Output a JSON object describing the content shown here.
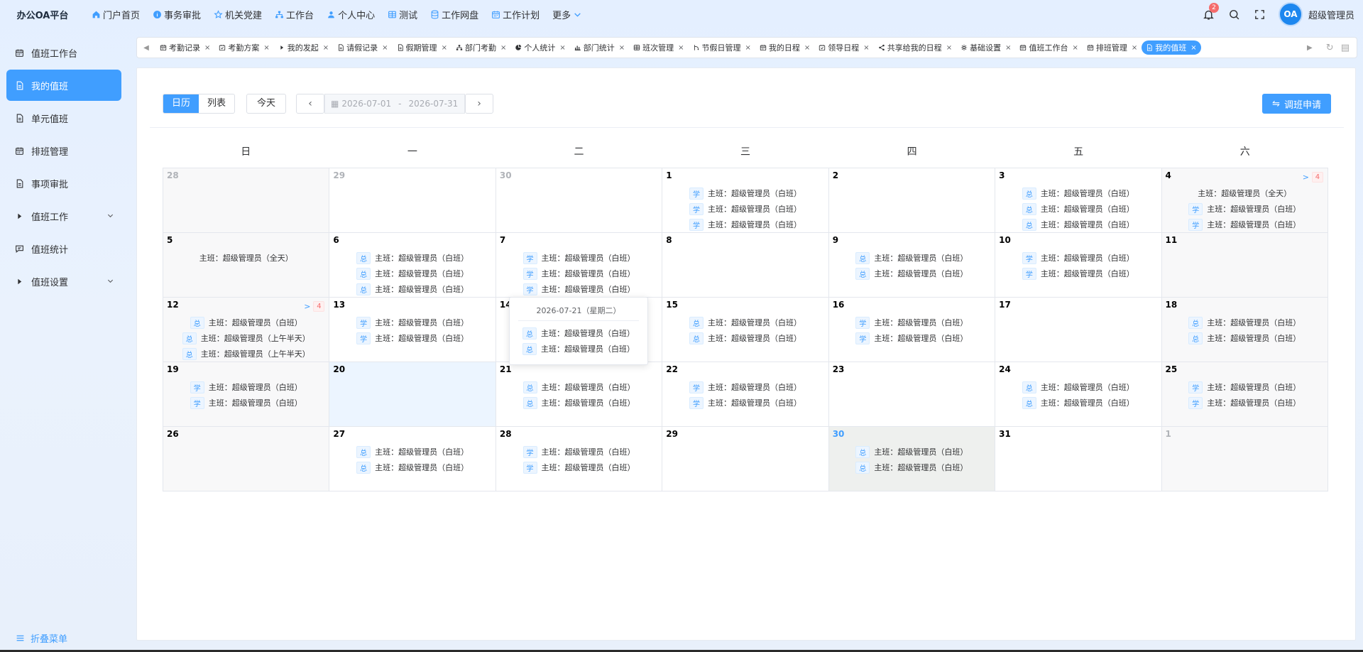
{
  "brand": "办公OA平台",
  "topnav": [
    {
      "label": "门户首页",
      "icon": "home-icon"
    },
    {
      "label": "事务审批",
      "icon": "info-icon"
    },
    {
      "label": "机关党建",
      "icon": "star-icon"
    },
    {
      "label": "工作台",
      "icon": "sitemap-icon"
    },
    {
      "label": "个人中心",
      "icon": "user-icon"
    },
    {
      "label": "测试",
      "icon": "grid-icon"
    },
    {
      "label": "工作网盘",
      "icon": "database-icon"
    },
    {
      "label": "工作计划",
      "icon": "calendar-icon"
    },
    {
      "label": "更多",
      "icon": "chevron-down-icon"
    }
  ],
  "user": {
    "name": "超级管理员",
    "avatar_text": "OA",
    "notify_count": "2"
  },
  "sidebar": {
    "items": [
      {
        "label": "值班工作台",
        "icon": "calendar-icon"
      },
      {
        "label": "我的值班",
        "icon": "document-icon",
        "active": true
      },
      {
        "label": "单元值班",
        "icon": "document-icon"
      },
      {
        "label": "排班管理",
        "icon": "calendar-icon"
      },
      {
        "label": "事项审批",
        "icon": "document-icon"
      },
      {
        "label": "值班工作",
        "icon": "caret-right-icon",
        "expandable": true
      },
      {
        "label": "值班统计",
        "icon": "chat-icon"
      },
      {
        "label": "值班设置",
        "icon": "caret-right-icon",
        "expandable": true
      }
    ],
    "collapse_label": "折叠菜单"
  },
  "tabs": [
    {
      "label": "考勤记录",
      "icon": "calendar-icon"
    },
    {
      "label": "考勤方案",
      "icon": "calendar-check-icon"
    },
    {
      "label": "我的发起",
      "icon": "caret-right-icon"
    },
    {
      "label": "请假记录",
      "icon": "document-icon"
    },
    {
      "label": "假期管理",
      "icon": "document-icon"
    },
    {
      "label": "部门考勤",
      "icon": "sitemap-icon"
    },
    {
      "label": "个人统计",
      "icon": "pie-icon"
    },
    {
      "label": "部门统计",
      "icon": "bar-icon"
    },
    {
      "label": "班次管理",
      "icon": "grid-icon"
    },
    {
      "label": "节假日管理",
      "icon": "branch-icon"
    },
    {
      "label": "我的日程",
      "icon": "calendar-icon"
    },
    {
      "label": "领导日程",
      "icon": "calendar-check-icon"
    },
    {
      "label": "共享给我的日程",
      "icon": "share-icon"
    },
    {
      "label": "基础设置",
      "icon": "gear-icon"
    },
    {
      "label": "值班工作台",
      "icon": "calendar-icon"
    },
    {
      "label": "排班管理",
      "icon": "calendar-icon"
    },
    {
      "label": "我的值班",
      "icon": "document-icon",
      "active": true
    }
  ],
  "toolbar": {
    "view_calendar": "日历",
    "view_list": "列表",
    "today": "今天",
    "range_start": "2026-07-01",
    "range_sep": "-",
    "range_end": "2026-07-31",
    "apply_label": "调班申请"
  },
  "weekdays": [
    "日",
    "一",
    "二",
    "三",
    "四",
    "五",
    "六"
  ],
  "weeks": [
    [
      {
        "day": "28",
        "other": true,
        "weekend": true,
        "events": []
      },
      {
        "day": "29",
        "other": true,
        "events": []
      },
      {
        "day": "30",
        "other": true,
        "events": []
      },
      {
        "day": "1",
        "events": [
          {
            "tag": "学",
            "text": "主班：超级管理员（白班）"
          },
          {
            "tag": "学",
            "text": "主班：超级管理员（白班）"
          },
          {
            "tag": "学",
            "text": "主班：超级管理员（白班）"
          }
        ]
      },
      {
        "day": "2",
        "events": []
      },
      {
        "day": "3",
        "events": [
          {
            "tag": "总",
            "text": "主班：超级管理员（白班）"
          },
          {
            "tag": "总",
            "text": "主班：超级管理员（白班）"
          },
          {
            "tag": "总",
            "text": "主班：超级管理员（白班）"
          }
        ]
      },
      {
        "day": "4",
        "weekend": true,
        "more": "4",
        "events": [
          {
            "tag": "",
            "text": "主班：超级管理员（全天）"
          },
          {
            "tag": "学",
            "text": "主班：超级管理员（白班）"
          },
          {
            "tag": "学",
            "text": "主班：超级管理员（白班）"
          }
        ]
      }
    ],
    [
      {
        "day": "5",
        "weekend": true,
        "events": [
          {
            "tag": "",
            "text": "主班：超级管理员（全天）"
          }
        ]
      },
      {
        "day": "6",
        "events": [
          {
            "tag": "总",
            "text": "主班：超级管理员（白班）"
          },
          {
            "tag": "总",
            "text": "主班：超级管理员（白班）"
          },
          {
            "tag": "总",
            "text": "主班：超级管理员（白班）"
          }
        ]
      },
      {
        "day": "7",
        "events": [
          {
            "tag": "学",
            "text": "主班：超级管理员（白班）"
          },
          {
            "tag": "学",
            "text": "主班：超级管理员（白班）"
          },
          {
            "tag": "学",
            "text": "主班：超级管理员（白班）"
          }
        ]
      },
      {
        "day": "8",
        "events": []
      },
      {
        "day": "9",
        "events": [
          {
            "tag": "总",
            "text": "主班：超级管理员（白班）"
          },
          {
            "tag": "总",
            "text": "主班：超级管理员（白班）"
          }
        ]
      },
      {
        "day": "10",
        "events": [
          {
            "tag": "学",
            "text": "主班：超级管理员（白班）"
          },
          {
            "tag": "学",
            "text": "主班：超级管理员（白班）"
          }
        ]
      },
      {
        "day": "11",
        "weekend": true,
        "events": []
      }
    ],
    [
      {
        "day": "12",
        "weekend": true,
        "more": "4",
        "events": [
          {
            "tag": "总",
            "text": "主班：超级管理员（白班）"
          },
          {
            "tag": "总",
            "text": "主班：超级管理员（上午半天）"
          },
          {
            "tag": "总",
            "text": "主班：超级管理员（上午半天）"
          }
        ]
      },
      {
        "day": "13",
        "events": [
          {
            "tag": "学",
            "text": "主班：超级管理员（白班）"
          },
          {
            "tag": "学",
            "text": "主班：超级管理员（白班）"
          }
        ]
      },
      {
        "day": "14",
        "events": []
      },
      {
        "day": "15",
        "events": [
          {
            "tag": "总",
            "text": "主班：超级管理员（白班）"
          },
          {
            "tag": "总",
            "text": "主班：超级管理员（白班）"
          }
        ]
      },
      {
        "day": "16",
        "events": [
          {
            "tag": "学",
            "text": "主班：超级管理员（白班）"
          },
          {
            "tag": "学",
            "text": "主班：超级管理员（白班）"
          }
        ]
      },
      {
        "day": "17",
        "events": []
      },
      {
        "day": "18",
        "weekend": true,
        "events": [
          {
            "tag": "总",
            "text": "主班：超级管理员（白班）"
          },
          {
            "tag": "总",
            "text": "主班：超级管理员（白班）"
          }
        ]
      }
    ],
    [
      {
        "day": "19",
        "weekend": true,
        "events": [
          {
            "tag": "学",
            "text": "主班：超级管理员（白班）"
          },
          {
            "tag": "学",
            "text": "主班：超级管理员（白班）"
          }
        ]
      },
      {
        "day": "20",
        "selected": true,
        "events": []
      },
      {
        "day": "21",
        "events": [
          {
            "tag": "总",
            "text": "主班：超级管理员（白班）"
          },
          {
            "tag": "总",
            "text": "主班：超级管理员（白班）"
          }
        ]
      },
      {
        "day": "22",
        "events": [
          {
            "tag": "学",
            "text": "主班：超级管理员（白班）"
          },
          {
            "tag": "学",
            "text": "主班：超级管理员（白班）"
          }
        ]
      },
      {
        "day": "23",
        "events": []
      },
      {
        "day": "24",
        "events": [
          {
            "tag": "总",
            "text": "主班：超级管理员（白班）"
          },
          {
            "tag": "总",
            "text": "主班：超级管理员（白班）"
          }
        ]
      },
      {
        "day": "25",
        "weekend": true,
        "events": [
          {
            "tag": "学",
            "text": "主班：超级管理员（白班）"
          },
          {
            "tag": "学",
            "text": "主班：超级管理员（白班）"
          }
        ]
      }
    ],
    [
      {
        "day": "26",
        "weekend": true,
        "events": []
      },
      {
        "day": "27",
        "events": [
          {
            "tag": "总",
            "text": "主班：超级管理员（白班）"
          },
          {
            "tag": "总",
            "text": "主班：超级管理员（白班）"
          }
        ]
      },
      {
        "day": "28",
        "events": [
          {
            "tag": "学",
            "text": "主班：超级管理员（白班）"
          },
          {
            "tag": "学",
            "text": "主班：超级管理员（白班）"
          }
        ]
      },
      {
        "day": "29",
        "events": []
      },
      {
        "day": "30",
        "today": true,
        "events": [
          {
            "tag": "总",
            "text": "主班：超级管理员（白班）"
          },
          {
            "tag": "总",
            "text": "主班：超级管理员（白班）"
          }
        ]
      },
      {
        "day": "31",
        "events": []
      },
      {
        "day": "1",
        "other": true,
        "weekend": true,
        "events": []
      }
    ]
  ],
  "popover": {
    "title": "2026-07-21（星期二）",
    "events": [
      {
        "tag": "总",
        "text": "主班：超级管理员（白班）"
      },
      {
        "tag": "总",
        "text": "主班：超级管理员（白班）"
      }
    ]
  },
  "colors": {
    "accent": "#409eff",
    "danger": "#f56c6c",
    "today_bg": "#eef0ee",
    "selected_bg": "#ecf5ff"
  }
}
